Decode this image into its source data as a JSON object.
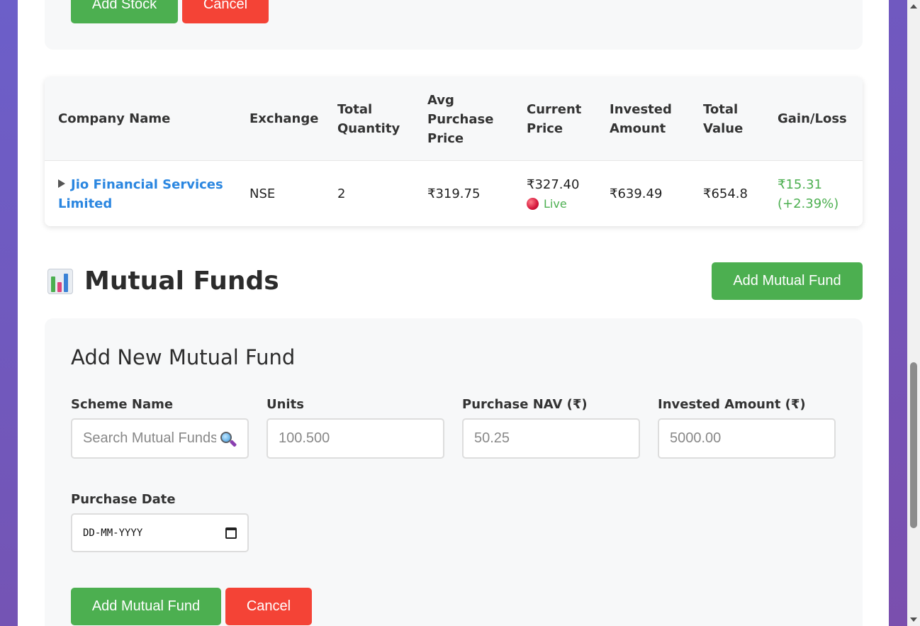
{
  "stock_form": {
    "add_button": "Add Stock",
    "cancel_button": "Cancel"
  },
  "stocks_table": {
    "headers": {
      "company_name": "Company Name",
      "exchange": "Exchange",
      "total_quantity_1": "Total",
      "total_quantity_2": "Quantity",
      "avg_price_1": "Avg",
      "avg_price_2": "Purchase",
      "avg_price_3": "Price",
      "current_price_1": "Current",
      "current_price_2": "Price",
      "invested_1": "Invested",
      "invested_2": "Amount",
      "total_value_1": "Total",
      "total_value_2": "Value",
      "gain_loss": "Gain/Loss"
    },
    "rows": [
      {
        "company_line1": "Jio Financial Services",
        "company_line2": "Limited",
        "exchange": "NSE",
        "quantity": "2",
        "avg_price": "₹319.75",
        "current_price": "₹327.40",
        "live_label": "Live",
        "invested": "₹639.49",
        "total_value": "₹654.8",
        "gain": "₹15.31",
        "gain_pct": "(+2.39%)"
      }
    ]
  },
  "mutual_funds": {
    "title": "Mutual Funds",
    "icon": "bar-chart-icon",
    "add_button": "Add Mutual Fund",
    "form": {
      "heading": "Add New Mutual Fund",
      "scheme_name_label": "Scheme Name",
      "scheme_name_placeholder": "Search Mutual Funds...",
      "units_label": "Units",
      "units_placeholder": "100.500",
      "nav_label": "Purchase NAV (₹)",
      "nav_placeholder": "50.25",
      "invested_label": "Invested Amount (₹)",
      "invested_placeholder": "5000.00",
      "date_label": "Purchase Date",
      "date_placeholder": "DD-MM-YYYY",
      "submit_button": "Add Mutual Fund",
      "cancel_button": "Cancel"
    }
  },
  "colors": {
    "accent_green": "#4caf50",
    "danger_red": "#f44336",
    "link_blue": "#2a86e0",
    "background_purple": "#7a63c4"
  }
}
